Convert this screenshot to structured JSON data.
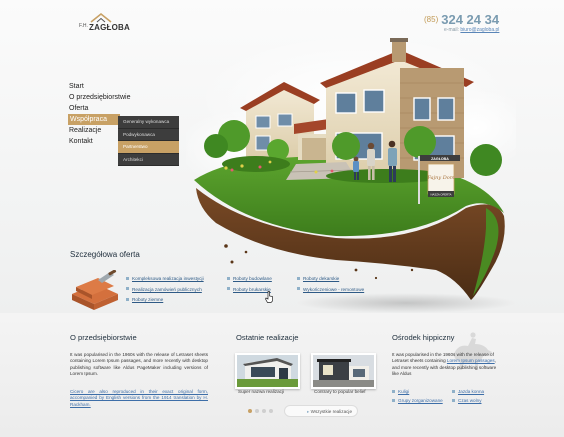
{
  "header": {
    "logo_prefix": "F.H.",
    "logo_name": "ZAGŁOBA",
    "phone_prefix": "(85)",
    "phone": "324 24 34",
    "email_label": "e-mail:",
    "email": "biuro@zagloba.pl"
  },
  "nav": {
    "items": [
      {
        "label": "Start"
      },
      {
        "label": "O przedsiębiorstwie"
      },
      {
        "label": "Oferta"
      },
      {
        "label": "Współpraca"
      },
      {
        "label": "Realizacje"
      },
      {
        "label": "Kontakt"
      }
    ],
    "active_index": 3,
    "submenu": [
      {
        "label": "Generalny wykonawca"
      },
      {
        "label": "Podwykonawca"
      },
      {
        "label": "Partnerstwo"
      },
      {
        "label": "Architekci"
      }
    ],
    "submenu_active_index": 2
  },
  "hero": {
    "sign_brand": "ZAGŁOBA",
    "sign_script": "Fajny Dom",
    "sign_footer": "NASZA OFERTA"
  },
  "offer": {
    "title": "Szczegółowa oferta",
    "col1": [
      "Kompleksowa realizacja inwestycji",
      "Realizacja zamówień publicznych",
      "Roboty ziemne"
    ],
    "col2": [
      "Roboty budowlane",
      "Roboty brukarskie"
    ],
    "col3": [
      "Roboty dekarskie",
      "Wykończeniowe - remontowe"
    ]
  },
  "company": {
    "title": "O przedsiębiorstwie",
    "paragraph1": "It was popularised in the 1960s with the release of Letraset sheets containing Lorem Ipsum passages, and more recently with desktop publishing software like Aldus PageMaker including versions of Lorem Ipsum.",
    "paragraph2": "Cicero are also reproduced in their exact original form, accompanied by English versions from the 1914 translation by H. Rackham."
  },
  "projects": {
    "title": "Ostatnie realizacje",
    "items": [
      {
        "caption": "Super nazwa realizacji"
      },
      {
        "caption": "Contrary to popular belief"
      }
    ],
    "all_label": "Wszystkie realizacje",
    "dots_count": 4,
    "active_dot": 0
  },
  "riding": {
    "title": "Ośrodek hippiczny",
    "paragraph_start": "It was popularised in the 1960s with the release of Letraset sheets containing ",
    "paragraph_link": "Lorem Ipsum passages",
    "paragraph_end": ", and more recently with desktop publishing software like Aldus",
    "links_col1": [
      "Kuligi",
      "Grupy zorganizowane"
    ],
    "links_col2": [
      "Jazda konna",
      "Czas wolny"
    ]
  },
  "colors": {
    "accent": "#c8a165",
    "submenu_bg": "#3d3d3d",
    "link": "#2e5a86",
    "phone": "#7a9bb0"
  }
}
